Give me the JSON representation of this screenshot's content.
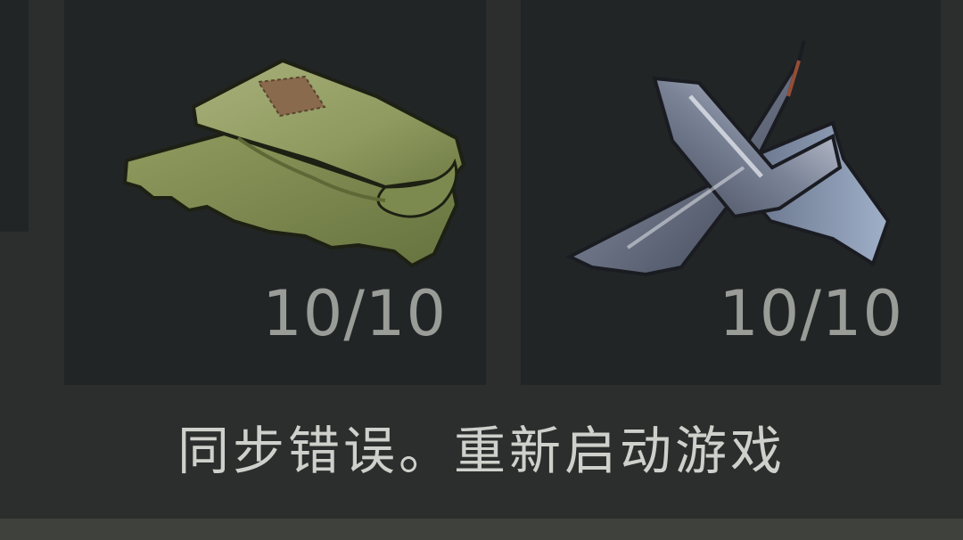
{
  "inventory": {
    "items": [
      {
        "icon": "folded-cloth-icon",
        "count": "10/10"
      },
      {
        "icon": "scrap-metal-icon",
        "count": "10/10"
      }
    ]
  },
  "message": {
    "text": "同步错误。重新启动游戏"
  },
  "colors": {
    "background": "#2b2e2d",
    "slot": "#212526",
    "count_text": "#9a9c98",
    "message_text": "#cfd0cb",
    "bottom_strip": "#3f423c"
  }
}
